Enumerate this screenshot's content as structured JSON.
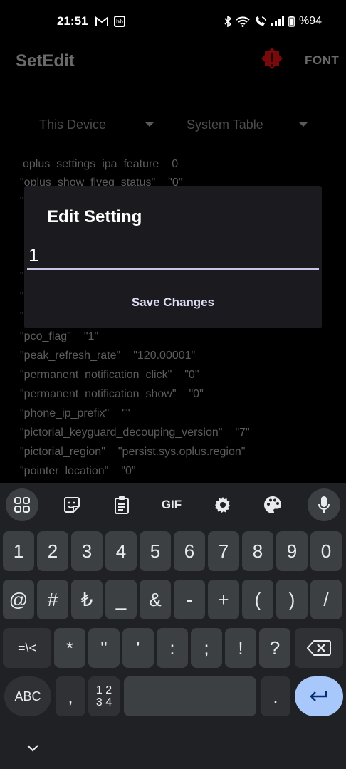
{
  "status_bar": {
    "time": "21:51",
    "left_icons": [
      "gmail-icon",
      "hb-app-icon"
    ],
    "hb_label": "hb",
    "right_icons": [
      "bluetooth-icon",
      "wifi-icon",
      "wifi-call-icon",
      "signal-icon",
      "battery-icon"
    ],
    "battery_text": "%94"
  },
  "app_bar": {
    "title": "SetEdit",
    "font_button": "FONT",
    "warning_icon": "alert-badge-icon"
  },
  "filters": {
    "device": "This Device",
    "table": "System Table"
  },
  "settings": [
    {
      "key": "oplus_settings_ipa_feature",
      "value": "0"
    },
    {
      "key": "\"oplus_show_fiveg_status\"",
      "value": "\"0\""
    },
    {
      "key": "\"pco_flag\"",
      "value": "\"1\""
    },
    {
      "key": "\"peak_refresh_rate\"",
      "value": "\"120.00001\""
    },
    {
      "key": "\"permanent_notification_click\"",
      "value": "\"0\""
    },
    {
      "key": "\"permanent_notification_show\"",
      "value": "\"0\""
    },
    {
      "key": "\"phone_ip_prefix\"",
      "value": "\"\""
    },
    {
      "key": "\"pictorial_keyguard_decouping_version\"",
      "value": "\"7\""
    },
    {
      "key": "\"pictorial_region\"",
      "value": "\"persist.sys.oplus.region\""
    },
    {
      "key": "\"pointer_location\"",
      "value": "\"0\""
    }
  ],
  "dialog": {
    "title": "Edit Setting",
    "value": "1",
    "save_label": "Save Changes"
  },
  "keyboard": {
    "toolbar": [
      "apps-grid-icon",
      "sticker-icon",
      "clipboard-icon",
      "gif-icon",
      "settings-gear-icon",
      "palette-icon",
      "mic-icon"
    ],
    "gif_label": "GIF",
    "row1": [
      "1",
      "2",
      "3",
      "4",
      "5",
      "6",
      "7",
      "8",
      "9",
      "0"
    ],
    "row2": [
      "@",
      "#",
      "₺",
      "_",
      "&",
      "-",
      "+",
      "(",
      ")",
      "/"
    ],
    "row3": [
      "=\\<",
      "*",
      "\"",
      "'",
      ":",
      ";",
      "!",
      "?"
    ],
    "abc_label": "ABC",
    "comma": ",",
    "numpad_label_top": "1 2",
    "numpad_label_bottom": "3 4",
    "period": ".",
    "colors": {
      "enter": "#a8c7fa",
      "key": "#3c4043",
      "background": "#202124"
    }
  }
}
